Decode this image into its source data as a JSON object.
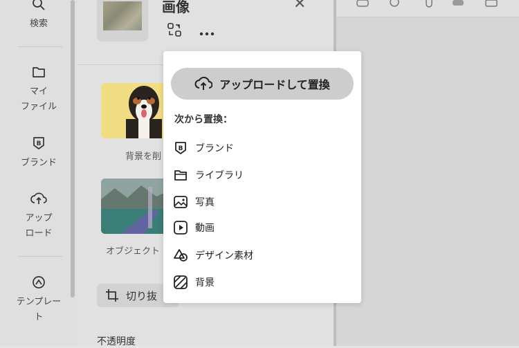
{
  "nav": {
    "search": "検索",
    "my_files": "マイ\nファイル",
    "brand": "ブランド",
    "upload": "アップ\nロード",
    "templates": "テンプレー\nト"
  },
  "panel": {
    "title": "画像",
    "close": "✕",
    "card1_label": "背景を削",
    "card2_label": "オブジェクト",
    "crop_label": "切り抜",
    "opacity_label": "不透明度"
  },
  "menu": {
    "upload_label": "アップロードして置換",
    "subheading": "次から置換：",
    "items": [
      {
        "label": "ブランド",
        "icon": "brand-icon"
      },
      {
        "label": "ライブラリ",
        "icon": "folder-icon"
      },
      {
        "label": "写真",
        "icon": "photo-icon"
      },
      {
        "label": "動画",
        "icon": "video-icon"
      },
      {
        "label": "デザイン素材",
        "icon": "shapes-icon"
      },
      {
        "label": "背景",
        "icon": "background-icon"
      }
    ]
  }
}
